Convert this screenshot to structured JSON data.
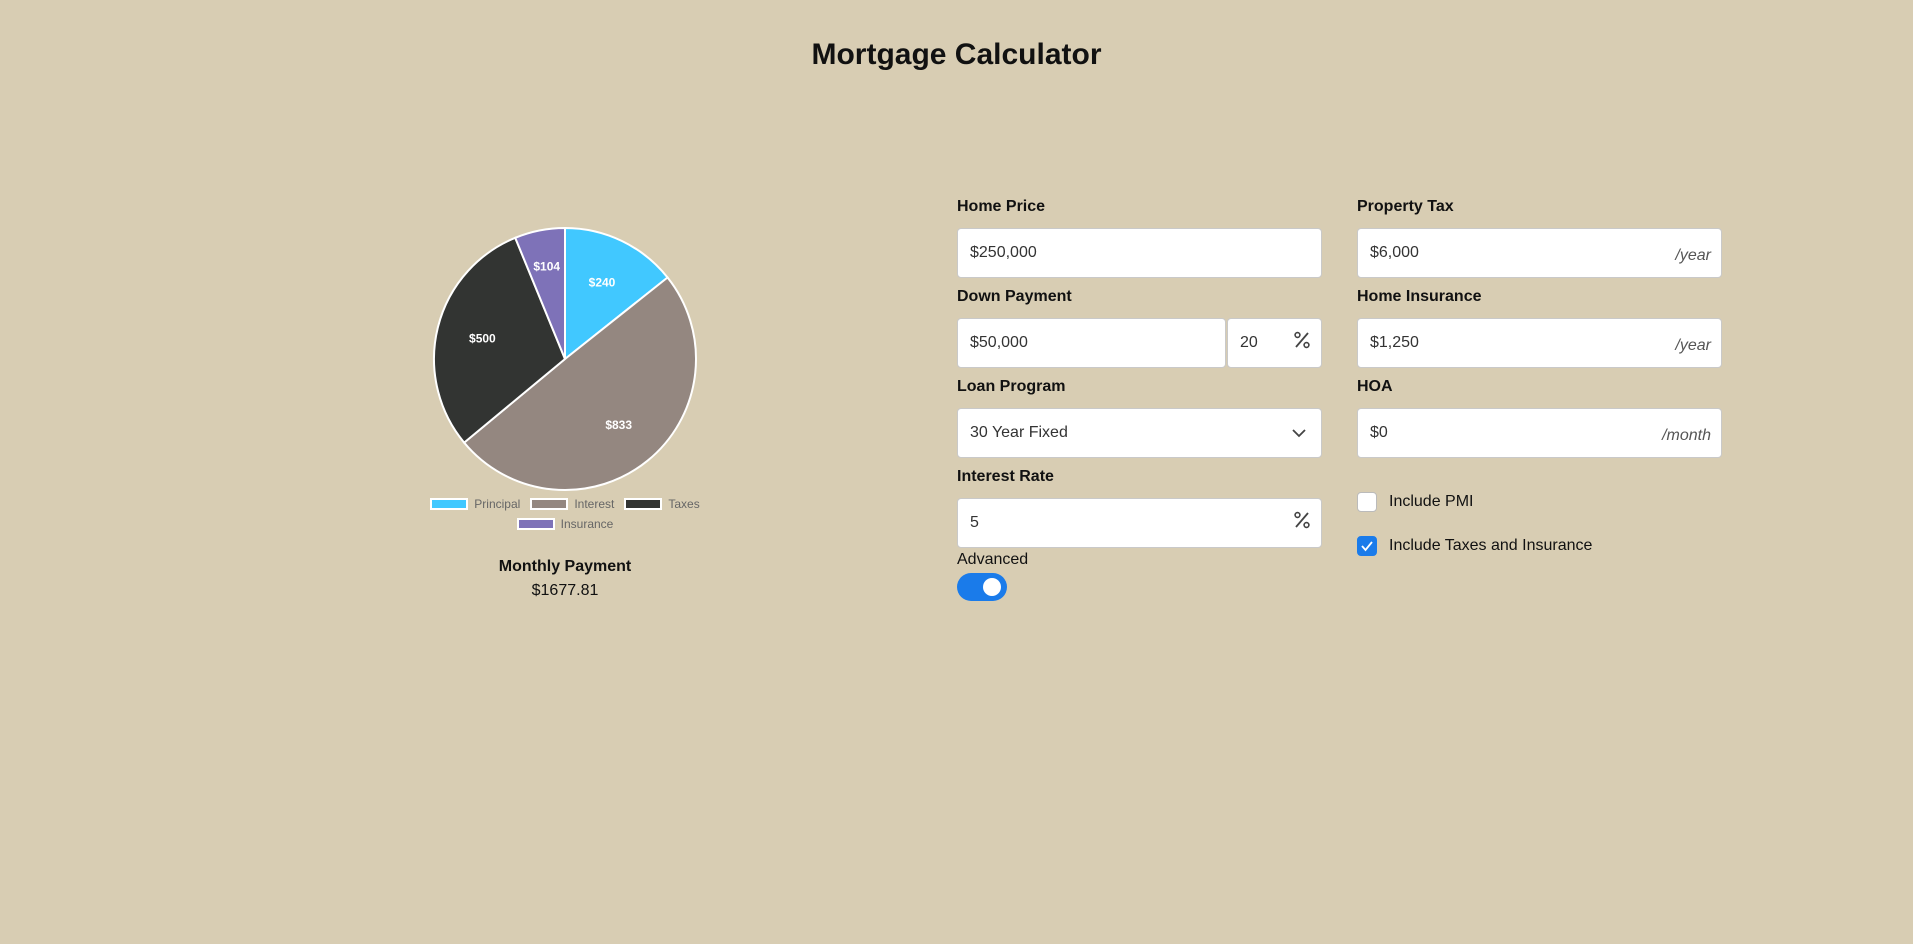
{
  "page": {
    "title": "Mortgage Calculator"
  },
  "chart_data": {
    "type": "pie",
    "slices": [
      {
        "name": "Principal",
        "value": 240,
        "label": "$240",
        "color": "#41c8ff"
      },
      {
        "name": "Interest",
        "value": 833,
        "label": "$833",
        "color": "#948780"
      },
      {
        "name": "Taxes",
        "value": 500,
        "label": "$500",
        "color": "#323432"
      },
      {
        "name": "Insurance",
        "value": 104,
        "label": "$104",
        "color": "#7e72b8"
      }
    ],
    "legend_position": "bottom"
  },
  "legend": {
    "items": [
      {
        "label": "Principal",
        "color": "#41c8ff"
      },
      {
        "label": "Interest",
        "color": "#948780"
      },
      {
        "label": "Taxes",
        "color": "#323432"
      },
      {
        "label": "Insurance",
        "color": "#7e72b8"
      }
    ]
  },
  "payment": {
    "label": "Monthly Payment",
    "value": "$1677.81"
  },
  "form": {
    "home_price": {
      "label": "Home Price",
      "value": "$250,000"
    },
    "down_payment": {
      "label": "Down Payment",
      "value": "$50,000",
      "percent": "20",
      "percent_icon": "percent-icon"
    },
    "loan_program": {
      "label": "Loan Program",
      "value": "30 Year Fixed",
      "icon": "chevron-down-icon"
    },
    "interest_rate": {
      "label": "Interest Rate",
      "value": "5",
      "percent_icon": "percent-icon"
    },
    "advanced": {
      "label": "Advanced",
      "enabled": true,
      "accent": "#1a7bea"
    },
    "property_tax": {
      "label": "Property Tax",
      "value": "$6,000",
      "suffix": "/year"
    },
    "home_insurance": {
      "label": "Home Insurance",
      "value": "$1,250",
      "suffix": "/year"
    },
    "hoa": {
      "label": "HOA",
      "value": "$0",
      "suffix": "/month"
    },
    "include_pmi": {
      "label": "Include PMI",
      "checked": false
    },
    "include_taxes_insurance": {
      "label": "Include Taxes and Insurance",
      "checked": true
    }
  }
}
